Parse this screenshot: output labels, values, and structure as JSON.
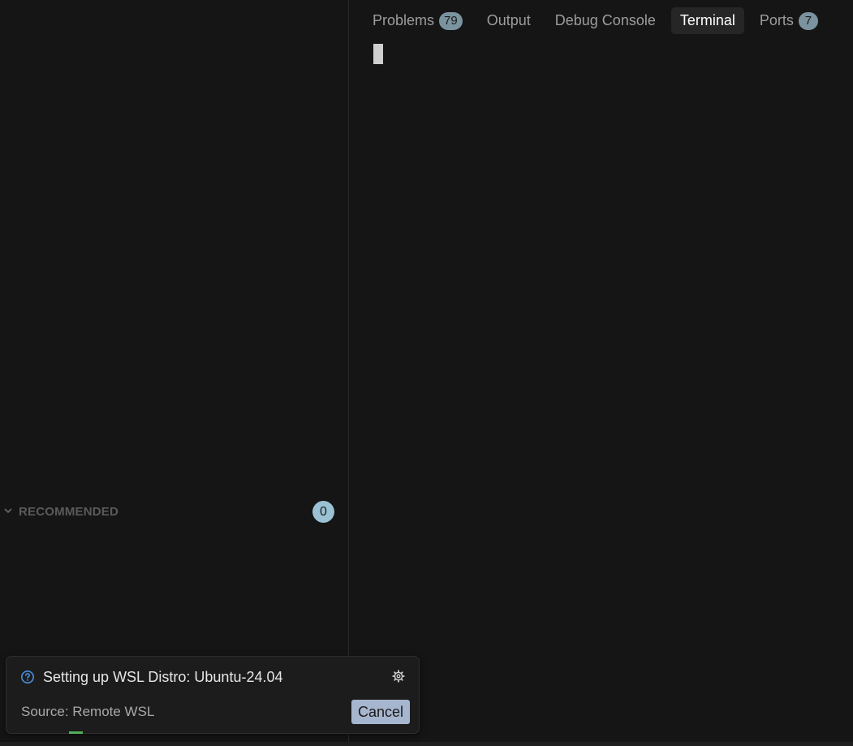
{
  "panel": {
    "tabs": [
      {
        "label": "Problems",
        "badge": "79"
      },
      {
        "label": "Output"
      },
      {
        "label": "Debug Console"
      },
      {
        "label": "Terminal",
        "active": true
      },
      {
        "label": "Ports",
        "badge": "7"
      }
    ]
  },
  "sidebar": {
    "section_title": "RECOMMENDED",
    "section_count": "0"
  },
  "notification": {
    "message": "Setting up WSL Distro: Ubuntu-24.04",
    "source": "Source: Remote WSL",
    "cancel_label": "Cancel",
    "icons": {
      "info": "info-icon",
      "settings": "gear-icon"
    }
  },
  "colors": {
    "background": "#151515",
    "badge": "#7a939f",
    "button": "#a7b6cf",
    "progress": "#4fb05a",
    "info": "#4a8fe0"
  }
}
